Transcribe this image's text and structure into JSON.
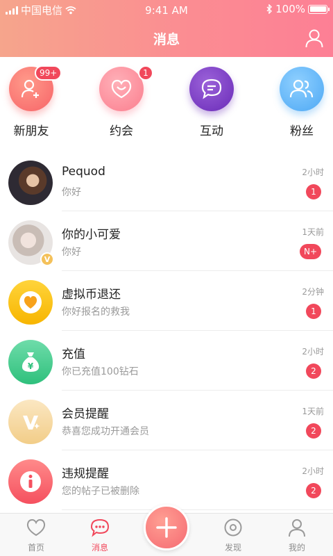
{
  "status_bar": {
    "carrier": "中国电信",
    "time": "9:41 AM",
    "battery": "100%"
  },
  "header": {
    "title": "消息",
    "profile_icon": "user-icon"
  },
  "categories": [
    {
      "label": "新朋友",
      "icon": "add-friend-icon",
      "badge": "99+"
    },
    {
      "label": "约会",
      "icon": "smile-heart-icon",
      "badge": "1"
    },
    {
      "label": "互动",
      "icon": "chat-bubble-icon",
      "badge": ""
    },
    {
      "label": "粉丝",
      "icon": "users-icon",
      "badge": ""
    }
  ],
  "messages": [
    {
      "name": "Pequod",
      "preview": "你好",
      "time": "2小时",
      "count": "1",
      "avatar": "photo"
    },
    {
      "name": "你的小可爱",
      "preview": "你好",
      "time": "1天前",
      "count": "N+",
      "avatar": "photo-vip"
    },
    {
      "name": "虚拟币退还",
      "preview": "你好报名的救我",
      "time": "2分钟",
      "count": "1",
      "avatar": "heart-coin-icon"
    },
    {
      "name": "充值",
      "preview": "你已充值100钻石",
      "time": "2小时",
      "count": "2",
      "avatar": "money-bag-icon"
    },
    {
      "name": "会员提醒",
      "preview": "恭喜您成功开通会员",
      "time": "1天前",
      "count": "2",
      "avatar": "vip-icon"
    },
    {
      "name": "违规提醒",
      "preview": "您的帖子已被删除",
      "time": "2小时",
      "count": "2",
      "avatar": "info-icon"
    }
  ],
  "tabs": [
    {
      "label": "首页",
      "icon": "heart-outline-icon",
      "active": false
    },
    {
      "label": "消息",
      "icon": "message-icon",
      "active": true
    },
    {
      "label": "发现",
      "icon": "discover-icon",
      "active": false
    },
    {
      "label": "我的",
      "icon": "user-icon",
      "active": false
    }
  ],
  "colors": {
    "accent": "#f1485b",
    "header_start": "#f6a58c",
    "header_end": "#fd7f95"
  }
}
